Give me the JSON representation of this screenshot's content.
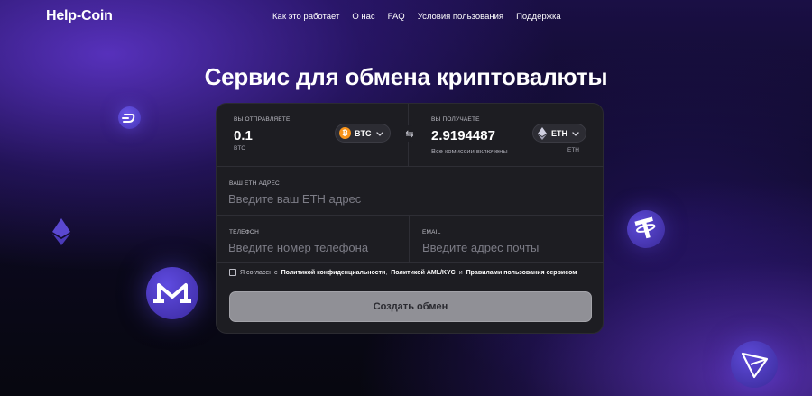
{
  "header": {
    "logo": "Help-Coin",
    "nav": [
      "Как это работает",
      "О нас",
      "FAQ",
      "Условия пользования",
      "Поддержка"
    ]
  },
  "hero": {
    "title": "Сервис для обмена криптовалюты"
  },
  "exchange": {
    "send": {
      "label": "ВЫ ОТПРАВЛЯЕТЕ",
      "amount": "0.1",
      "unit": "BTC",
      "currency": "BTC",
      "icon": "bitcoin-icon"
    },
    "receive": {
      "label": "ВЫ ПОЛУЧАЕТЕ",
      "amount": "2.9194487",
      "note": "Все комиссии включены",
      "unit": "ETH",
      "currency": "ETH",
      "icon": "ethereum-icon"
    },
    "swap_icon": "swap-arrows-icon"
  },
  "form": {
    "address": {
      "label": "ВАШ ETH АДРЕС",
      "placeholder": "Введите ваш ETH адрес"
    },
    "phone": {
      "label": "ТЕЛЕФОН",
      "placeholder": "Введите номер телефона"
    },
    "email": {
      "label": "EMAIL",
      "placeholder": "Введите адрес почты"
    },
    "agreement": {
      "prefix": "Я согласен с",
      "privacy": "Политикой конфиденциальности",
      "sep1": ",",
      "aml": "Политикой AML/KYC",
      "and": "и",
      "rules": "Правилами пользования сервисом"
    },
    "submit_label": "Создать обмен"
  },
  "colors": {
    "accent": "#6a56e8",
    "btc": "#f7931a",
    "card_bg": "#1d1d22",
    "button_bg": "#909096"
  }
}
